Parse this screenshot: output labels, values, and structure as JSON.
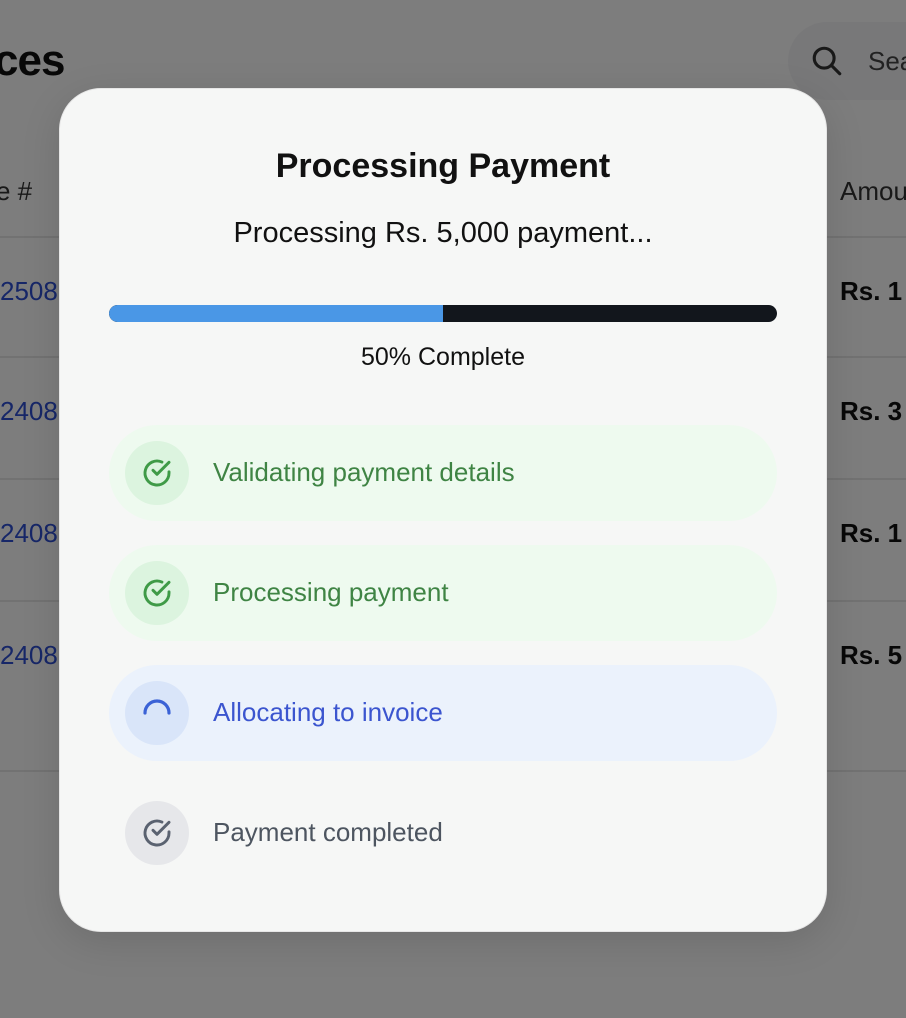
{
  "background": {
    "page_title": "ces",
    "search_placeholder": "Sea",
    "columns": {
      "left": "e #",
      "right": "Amou"
    },
    "rows": [
      {
        "invoice": "2508",
        "amount": "Rs. 1"
      },
      {
        "invoice": "2408",
        "amount": "Rs. 3"
      },
      {
        "invoice": "2408",
        "amount": "Rs. 1"
      },
      {
        "invoice": "2408",
        "amount": "Rs. 5"
      }
    ]
  },
  "modal": {
    "title": "Processing Payment",
    "subtitle": "Processing Rs. 5,000 payment...",
    "progress": {
      "value": 50,
      "label": "50% Complete"
    },
    "steps": [
      {
        "label": "Validating payment details",
        "status": "done",
        "icon": "check-circle-icon"
      },
      {
        "label": "Processing payment",
        "status": "done",
        "icon": "check-circle-icon"
      },
      {
        "label": "Allocating to invoice",
        "status": "active",
        "icon": "spinner-icon"
      },
      {
        "label": "Payment completed",
        "status": "pending",
        "icon": "check-circle-icon"
      }
    ]
  },
  "colors": {
    "progress_fill": "#4a97e6",
    "progress_track": "#12161c",
    "done_text": "#3f8444",
    "active_text": "#3b55cf",
    "pending_text": "#4d5560"
  }
}
